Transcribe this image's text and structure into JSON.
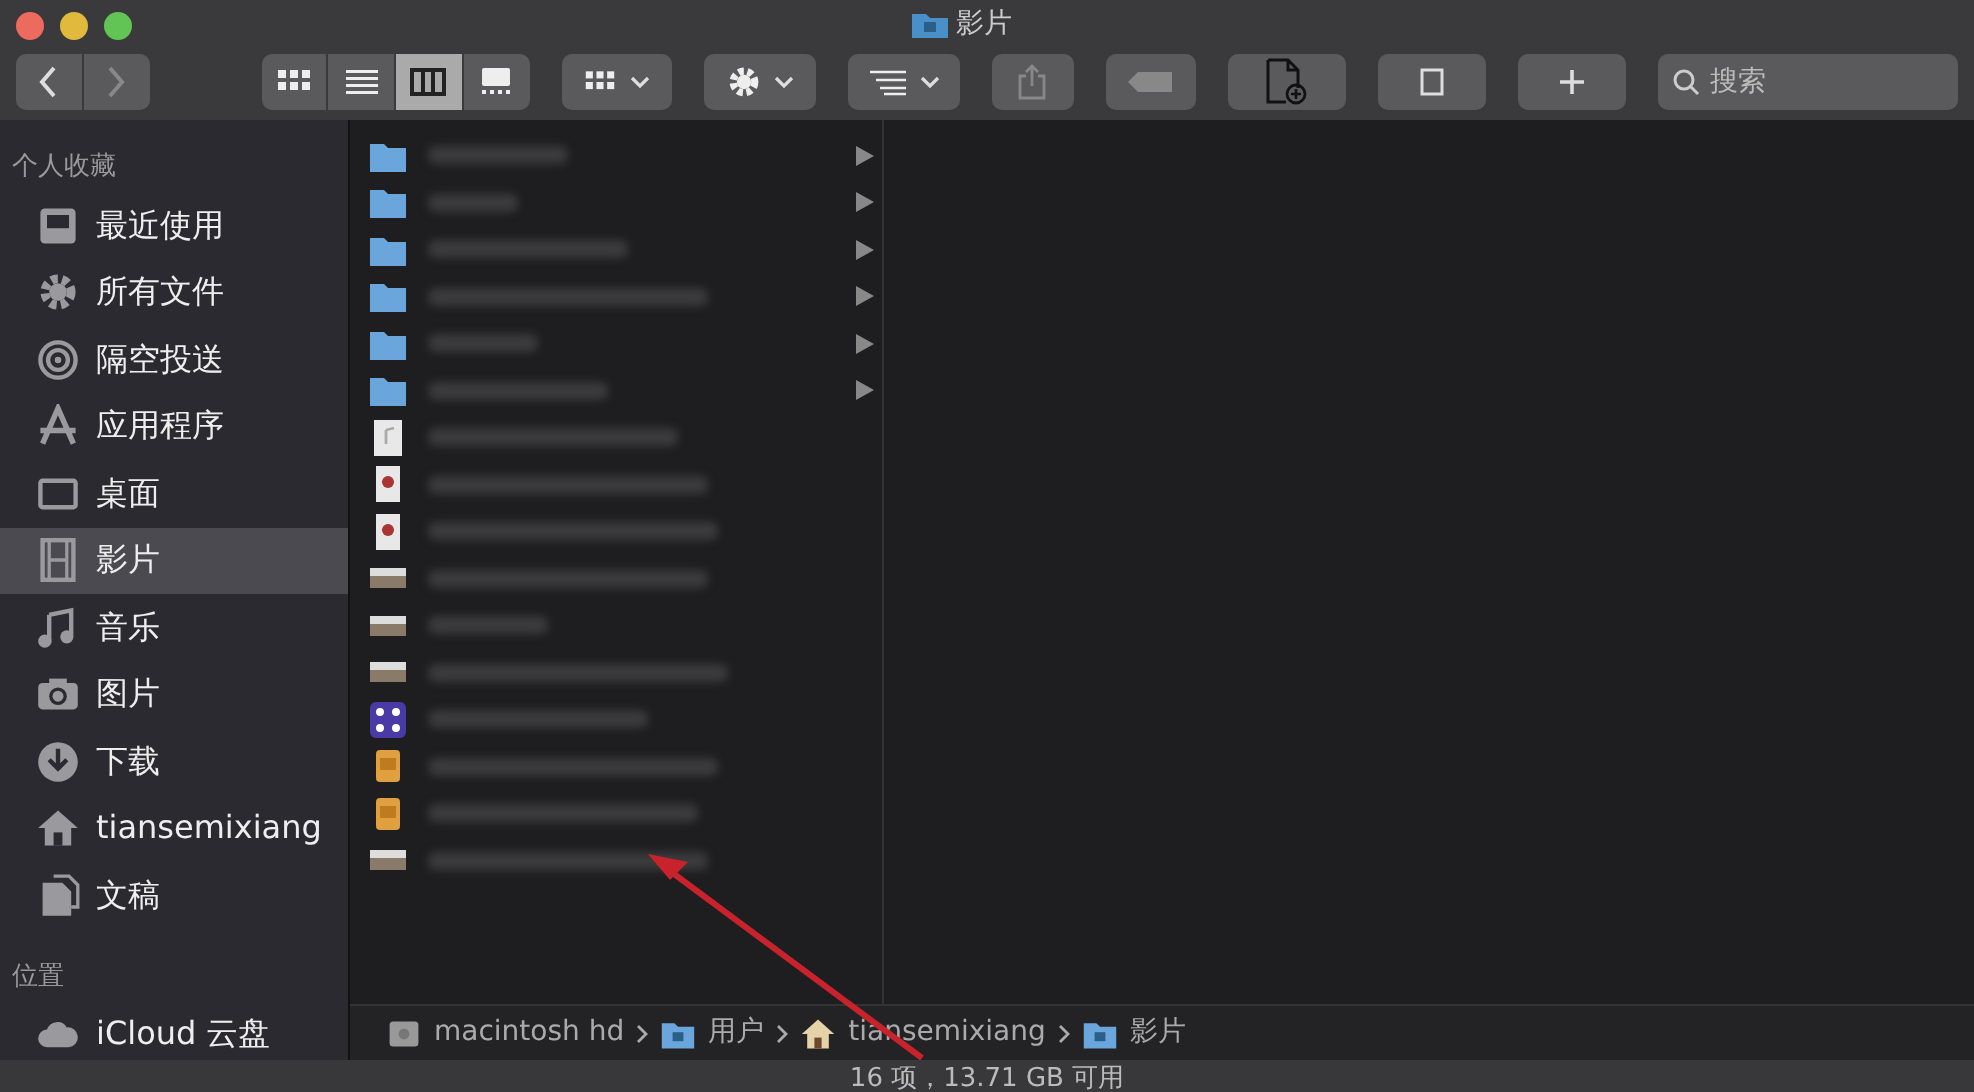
{
  "window": {
    "title": "影片"
  },
  "toolbar": {
    "view_modes": [
      {
        "kind": "icons",
        "selected": false
      },
      {
        "kind": "list",
        "selected": false
      },
      {
        "kind": "columns",
        "selected": true
      },
      {
        "kind": "gallery",
        "selected": false
      }
    ],
    "search": {
      "placeholder": "搜索"
    }
  },
  "sidebar": {
    "sections": [
      {
        "heading": "个人收藏",
        "items": [
          {
            "label": "最近使用",
            "kind": "recents",
            "selected": false
          },
          {
            "label": "所有文件",
            "kind": "gear",
            "selected": false
          },
          {
            "label": "隔空投送",
            "kind": "airdrop",
            "selected": false
          },
          {
            "label": "应用程序",
            "kind": "apps",
            "selected": false
          },
          {
            "label": "桌面",
            "kind": "desktop",
            "selected": false
          },
          {
            "label": "影片",
            "kind": "film",
            "selected": true
          },
          {
            "label": "音乐",
            "kind": "music",
            "selected": false
          },
          {
            "label": "图片",
            "kind": "camera",
            "selected": false
          },
          {
            "label": "下载",
            "kind": "download",
            "selected": false
          },
          {
            "label": "tiansemixiang",
            "kind": "home",
            "selected": false
          },
          {
            "label": "文稿",
            "kind": "docs",
            "selected": false
          }
        ]
      },
      {
        "heading": "位置",
        "items": [
          {
            "label": "iCloud 云盘",
            "kind": "cloud",
            "selected": false
          }
        ]
      }
    ]
  },
  "files": [
    {
      "kind": "folder",
      "expandable": true
    },
    {
      "kind": "folder",
      "expandable": true
    },
    {
      "kind": "folder",
      "expandable": true
    },
    {
      "kind": "folder",
      "expandable": true
    },
    {
      "kind": "folder",
      "expandable": true
    },
    {
      "kind": "folder",
      "expandable": true
    },
    {
      "kind": "audio",
      "expandable": false
    },
    {
      "kind": "document",
      "expandable": false
    },
    {
      "kind": "document",
      "expandable": false
    },
    {
      "kind": "video",
      "expandable": false
    },
    {
      "kind": "video",
      "expandable": false
    },
    {
      "kind": "video",
      "expandable": false
    },
    {
      "kind": "app",
      "expandable": false
    },
    {
      "kind": "library",
      "expandable": false
    },
    {
      "kind": "library",
      "expandable": false
    },
    {
      "kind": "video",
      "expandable": false
    }
  ],
  "path_bar": [
    {
      "label": "macintosh hd",
      "kind": "disk"
    },
    {
      "label": "用户",
      "kind": "folder"
    },
    {
      "label": "tiansemixiang",
      "kind": "home"
    },
    {
      "label": "影片",
      "kind": "folder"
    }
  ],
  "status_bar": "16 项，13.71 GB 可用"
}
